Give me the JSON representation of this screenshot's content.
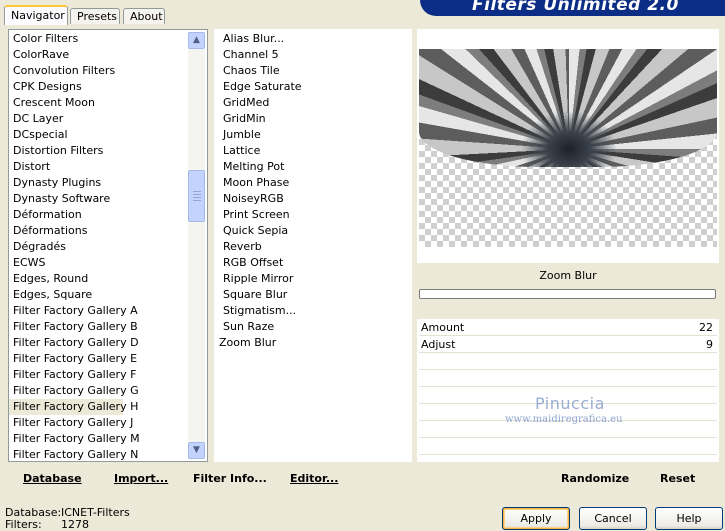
{
  "app": {
    "title": "Filters Unlimited 2.0"
  },
  "tabs": [
    {
      "label": "Navigator",
      "active": true
    },
    {
      "label": "Presets",
      "active": false
    },
    {
      "label": "About",
      "active": false
    }
  ],
  "categories": [
    "Color Filters",
    "ColorRave",
    "Convolution Filters",
    "CPK Designs",
    "Crescent Moon",
    "DC Layer",
    "DCspecial",
    "Distortion Filters",
    "Distort",
    "Dynasty Plugins",
    "Dynasty Software",
    "Déformation",
    "Déformations",
    "Dégradés",
    "ECWS",
    "Edges, Round",
    "Edges, Square",
    "Filter Factory Gallery A",
    "Filter Factory Gallery B",
    "Filter Factory Gallery D",
    "Filter Factory Gallery E",
    "Filter Factory Gallery F",
    "Filter Factory Gallery G",
    "Filter Factory Gallery H",
    "Filter Factory Gallery J",
    "Filter Factory Gallery M",
    "Filter Factory Gallery N"
  ],
  "categories_highlighted": "Filter Factory Gallery H",
  "filters": [
    "Alias Blur...",
    "Channel 5",
    "Chaos Tile",
    "Edge Saturate",
    "GridMed",
    "GridMin",
    "Jumble",
    "Lattice",
    "Melting Pot",
    "Moon Phase",
    "NoiseyRGB",
    "Print Screen",
    "Quick Sepia",
    "Reverb",
    "RGB Offset",
    "Ripple Mirror",
    "Square Blur",
    "Stigmatism...",
    "Sun Raze",
    "Zoom Blur"
  ],
  "filters_selected": "Zoom Blur",
  "preview": {
    "filter_label": "Zoom Blur"
  },
  "params": [
    {
      "name": "Amount",
      "value": "22"
    },
    {
      "name": "Adjust",
      "value": "9"
    }
  ],
  "watermark": {
    "name": "Pinuccia",
    "site": "www.maidiregrafica.eu"
  },
  "bottom_left": {
    "database": "Database",
    "import": "Import...",
    "filter_info": "Filter Info...",
    "editor": "Editor..."
  },
  "bottom_right": {
    "randomize": "Randomize",
    "reset": "Reset"
  },
  "status": {
    "database_label": "Database:",
    "database_value": "ICNET-Filters",
    "filters_label": "Filters:",
    "filters_value": "1278"
  },
  "buttons": {
    "apply": "Apply",
    "cancel": "Cancel",
    "help": "Help"
  },
  "colors": {
    "banner": "#0b2d86",
    "selection": "#316ac5",
    "window": "#ece9d8"
  }
}
